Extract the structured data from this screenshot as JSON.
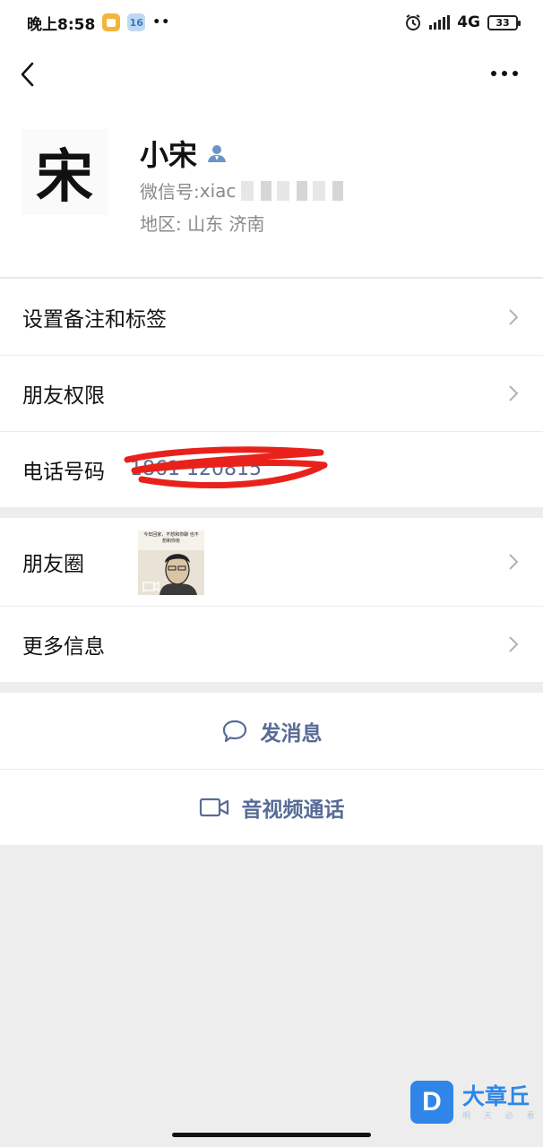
{
  "status_bar": {
    "time": "晚上8:58",
    "notif_badge": "16",
    "dots": "••",
    "network": "4G",
    "battery": "33",
    "icons": [
      "app-notification-icon",
      "calendar-badge-icon",
      "alarm-icon",
      "signal-icon",
      "battery-icon"
    ]
  },
  "nav": {
    "back_icon": "chevron-left-icon",
    "more_icon": "more-horizontal-icon"
  },
  "profile": {
    "avatar_char": "宋",
    "name": "小宋",
    "verified_icon": "contact-person-icon",
    "wechat_id_label": "微信号: ",
    "wechat_id_value": "xiac",
    "region": "地区:  山东  济南"
  },
  "settings_group": [
    {
      "label": "设置备注和标签"
    },
    {
      "label": "朋友权限"
    }
  ],
  "phone": {
    "label": "电话号码",
    "value": "1861  120815"
  },
  "moments": {
    "label": "朋友圈",
    "thumb_caption": "今年回家，不想和你聊\n也不想和你抢"
  },
  "more_info": {
    "label": "更多信息"
  },
  "actions": {
    "message_label": "发消息",
    "call_label": "音视频通话"
  },
  "watermark": {
    "logo": "D",
    "text": "大章丘",
    "sub": "明 天 必 看"
  },
  "colors": {
    "link": "#576b95",
    "background": "#ededed",
    "accent_blue": "#2f86e8",
    "scribble": "#e8221b"
  }
}
